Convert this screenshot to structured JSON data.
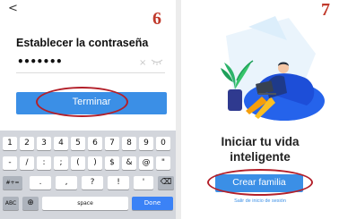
{
  "step6": {
    "step_number": "6",
    "back_icon": "chevron-left-icon",
    "title": "Establecer la contraseña",
    "password_value": "•••••••",
    "clear_glyph": "×",
    "finish_label": "Terminar",
    "accent_color": "#3b8fe6",
    "highlight_color": "#b3202a"
  },
  "keyboard": {
    "row1": [
      "1",
      "2",
      "3",
      "4",
      "5",
      "6",
      "7",
      "8",
      "9",
      "0"
    ],
    "row2": [
      "-",
      "/",
      ":",
      ";",
      "(",
      ")",
      "$",
      "&",
      "@",
      "\""
    ],
    "row3_mode": "#+=",
    "row3": [
      ".",
      ",",
      "?",
      "!",
      "'"
    ],
    "backspace_glyph": "⌫",
    "abc_label": "ABC",
    "globe_glyph": "⊕",
    "space_label": "space",
    "done_label": "Done"
  },
  "step7": {
    "step_number": "7",
    "headline_line1": "Iniciar tu vida",
    "headline_line2": "inteligente",
    "create_label": "Crear familia",
    "logout_link": "Salir de inicio de sesión"
  }
}
